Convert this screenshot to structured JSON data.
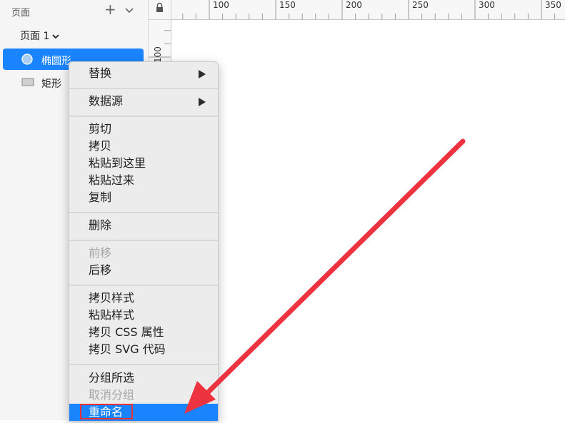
{
  "sidebar": {
    "header_title": "页面",
    "add_symbol": "+",
    "page_selector": "页面 1",
    "layers": [
      {
        "name": "椭圆形",
        "selected": true
      },
      {
        "name": "矩形",
        "selected": false
      }
    ]
  },
  "rulers": {
    "top_labels": [
      "100",
      "150",
      "200",
      "250",
      "300",
      "350"
    ],
    "left_labels": [
      "100"
    ]
  },
  "context_menu": {
    "groups": [
      [
        {
          "label": "替换",
          "submenu": true
        }
      ],
      [
        {
          "label": "数据源",
          "submenu": true
        }
      ],
      [
        {
          "label": "剪切"
        },
        {
          "label": "拷贝"
        },
        {
          "label": "粘贴到这里"
        },
        {
          "label": "粘贴过来"
        },
        {
          "label": "复制"
        }
      ],
      [
        {
          "label": "删除"
        }
      ],
      [
        {
          "label": "前移",
          "disabled": true
        },
        {
          "label": "后移"
        }
      ],
      [
        {
          "label": "拷贝样式"
        },
        {
          "label": "粘贴样式"
        },
        {
          "label": "拷贝 CSS 属性"
        },
        {
          "label": "拷贝 SVG 代码"
        }
      ],
      [
        {
          "label": "分组所选"
        },
        {
          "label": "取消分组",
          "disabled": true
        },
        {
          "label": "重命名",
          "highlighted": true
        }
      ]
    ]
  },
  "colors": {
    "accent": "#1a84ff",
    "annotation": "#e5323a"
  }
}
